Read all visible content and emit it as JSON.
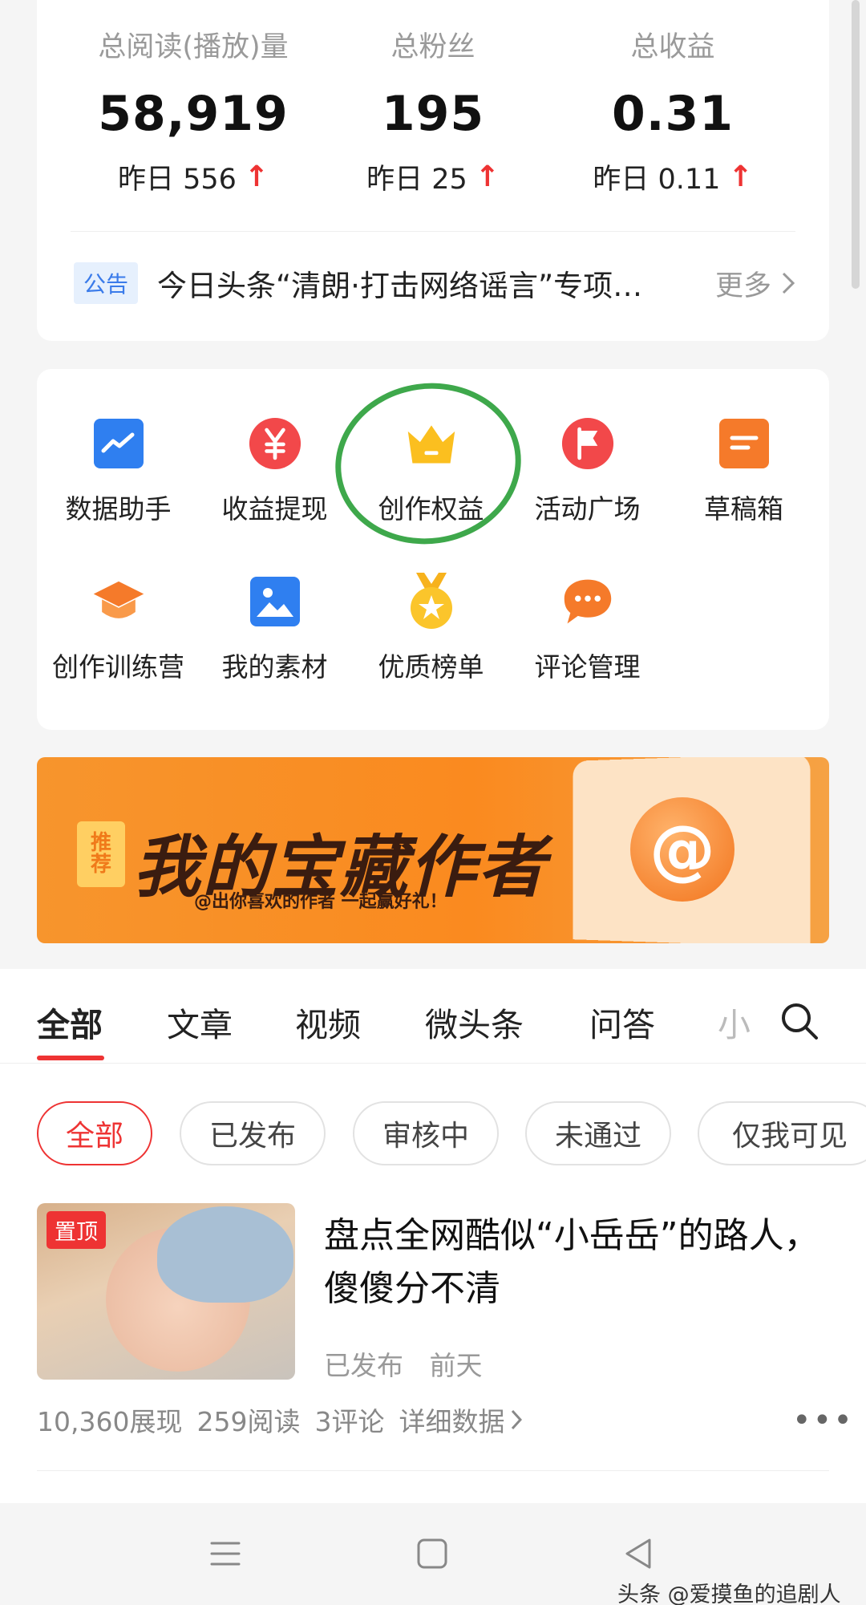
{
  "stats": [
    {
      "label": "总阅读(播放)量",
      "value": "58,919",
      "yesterday": "昨日 556"
    },
    {
      "label": "总粉丝",
      "value": "195",
      "yesterday": "昨日 25"
    },
    {
      "label": "总收益",
      "value": "0.31",
      "yesterday": "昨日 0.11"
    }
  ],
  "notice": {
    "tag": "公告",
    "text": "今日头条“清朗·打击网络谣言”专项整...",
    "more": "更多"
  },
  "tools": [
    {
      "label": "数据助手",
      "icon": "chart-icon"
    },
    {
      "label": "收益提现",
      "icon": "yuan-icon"
    },
    {
      "label": "创作权益",
      "icon": "crown-icon"
    },
    {
      "label": "活动广场",
      "icon": "flag-icon"
    },
    {
      "label": "草稿箱",
      "icon": "draft-icon"
    },
    {
      "label": "创作训练营",
      "icon": "graduation-cap-icon"
    },
    {
      "label": "我的素材",
      "icon": "image-icon"
    },
    {
      "label": "优质榜单",
      "icon": "medal-icon"
    },
    {
      "label": "评论管理",
      "icon": "comment-icon"
    }
  ],
  "banner": {
    "tag_line1": "推",
    "tag_line2": "荐",
    "title": "我的宝藏作者",
    "subtitle": "@出你喜欢的作者 一起赢好礼！",
    "at_symbol": "@"
  },
  "tabs": [
    "全部",
    "文章",
    "视频",
    "微头条",
    "问答",
    "小"
  ],
  "filters": [
    "全部",
    "已发布",
    "审核中",
    "未通过",
    "仅我可见"
  ],
  "article": {
    "pin": "置顶",
    "title": "盘点全网酷似“小岳岳”的路人，傻傻分不清",
    "status": "已发布",
    "time": "前天",
    "views": "10,360展现",
    "reads": "259阅读",
    "comments": "3评论",
    "details": "详细数据"
  },
  "watermark": "头条 @爱摸鱼的追剧人",
  "colors": {
    "accent": "#e33333",
    "tag_blue": "#3a7bea",
    "banner_orange": "#f7952d",
    "circle_green": "#3ea84b"
  }
}
